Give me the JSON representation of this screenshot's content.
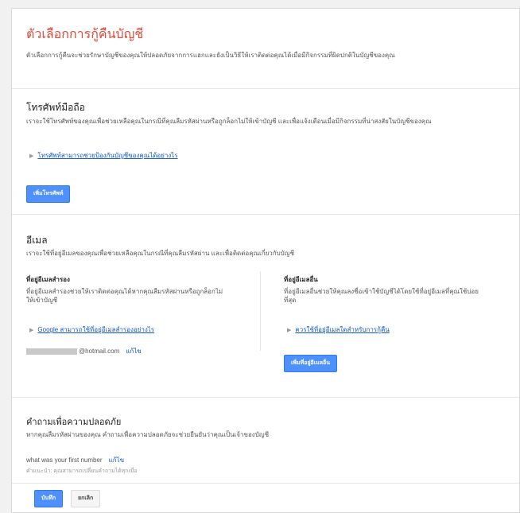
{
  "page": {
    "title": "ตัวเลือกการกู้คืนบัญชี",
    "intro": "ตัวเลือกการกู้คืนจะช่วยรักษาบัญชีของคุณให้ปลอดภัยจากการแฮกและยังเป็นวิธีให้เราติดต่อคุณได้เมื่อมีกิจกรรมที่ผิดปกติในบัญชีของคุณ"
  },
  "phone": {
    "title": "โทรศัพท์มือถือ",
    "desc": "เราจะใช้โทรศัพท์ของคุณเพื่อช่วยเหลือคุณในกรณีที่คุณลืมรหัสผ่านหรือถูกล็อกไม่ให้เข้าบัญชี และเพื่อแจ้งเตือนเมื่อมีกิจกรรมที่น่าสงสัยในบัญชีของคุณ",
    "link": "โทรศัพท์สามารถช่วยป้องกันบัญชีของคุณได้อย่างไร",
    "add_button": "เพิ่มโทรศัพท์"
  },
  "email": {
    "title": "อีเมล",
    "desc": "เราจะใช้ที่อยู่อีเมลของคุณเพื่อช่วยเหลือคุณในกรณีที่คุณลืมรหัสผ่าน และเพื่อติดต่อคุณเกี่ยวกับบัญชี",
    "recovery": {
      "title": "ที่อยู่อีเมลสำรอง",
      "desc": "ที่อยู่อีเมลสำรองช่วยให้เราติดต่อคุณได้หากคุณลืมรหัสผ่านหรือถูกล็อกไม่ให้เข้าบัญชี",
      "link": "Google สามารถใช้ที่อยู่อีเมลสำรองอย่างไร",
      "address_suffix": "@hotmail.com",
      "edit": "แก้ไข"
    },
    "alternate": {
      "title": "ที่อยู่อีเมลอื่น",
      "desc": "ที่อยู่อีเมลอื่นช่วยให้คุณลงชื่อเข้าใช้บัญชีได้โดยใช้ที่อยู่อีเมลที่คุณใช้บ่อยที่สุด",
      "link": "ควรใช้ที่อยู่อีเมลใดสำหรับการกู้คืน",
      "add_button": "เพิ่มที่อยู่อีเมลอื่น"
    }
  },
  "security": {
    "title": "คำถามเพื่อความปลอดภัย",
    "desc": "หากคุณลืมรหัสผ่านของคุณ คำถามเพื่อความปลอดภัยจะช่วยยืนยันว่าคุณเป็นเจ้าของบัญชี",
    "question": "what was your first number",
    "edit": "แก้ไข",
    "hint": "คำแนะนำ: คุณสามารถเปลี่ยนคำถามได้ทุกเมื่อ"
  },
  "footer": {
    "save": "บันทึก",
    "cancel": "ยกเลิก"
  }
}
